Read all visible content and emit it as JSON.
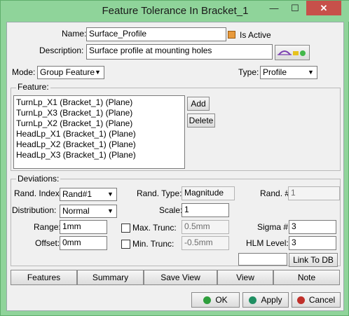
{
  "window": {
    "title": "Feature Tolerance In Bracket_1",
    "minimize_glyph": "—",
    "maximize_glyph": "☐",
    "close_glyph": "✕"
  },
  "header": {
    "name_label": "Name:",
    "name_value": "Surface_Profile",
    "is_active_label": "Is Active",
    "is_active_checked": true,
    "description_label": "Description:",
    "description_value": "Surface profile at mounting holes",
    "measure_icon": "measure-icon"
  },
  "mode": {
    "label": "Mode:",
    "value": "Group Feature",
    "type_label": "Type:",
    "type_value": "Profile"
  },
  "feature": {
    "group_label": "Feature:",
    "items": [
      "TurnLp_X1 (Bracket_1) (Plane)",
      "TurnLp_X3 (Bracket_1) (Plane)",
      "TurnLp_X2 (Bracket_1) (Plane)",
      "HeadLp_X1 (Bracket_1) (Plane)",
      "HeadLp_X2 (Bracket_1) (Plane)",
      "HeadLp_X3 (Bracket_1) (Plane)"
    ],
    "add_label": "Add",
    "delete_label": "Delete"
  },
  "deviations": {
    "group_label": "Deviations:",
    "rand_index_label": "Rand. Index:",
    "rand_index_value": "Rand#1",
    "rand_type_label": "Rand. Type:",
    "rand_type_value": "Magnitude",
    "rand_num_label": "Rand. #",
    "rand_num_value": "1",
    "distribution_label": "Distribution:",
    "distribution_value": "Normal",
    "scale_label": "Scale:",
    "scale_value": "1",
    "range_label": "Range:",
    "range_value": "1mm",
    "max_trunc_label": "Max. Trunc:",
    "max_trunc_value": "0.5mm",
    "sigma_label": "Sigma #",
    "sigma_value": "3",
    "offset_label": "Offset:",
    "offset_value": "0mm",
    "min_trunc_label": "Min. Trunc:",
    "min_trunc_value": "-0.5mm",
    "hlm_label": "HLM Level:",
    "hlm_value": "3",
    "link_label": "Link To DB"
  },
  "tabs": [
    "Features",
    "Summary",
    "Save View",
    "View",
    "Note"
  ],
  "footer": {
    "ok_label": "OK",
    "apply_label": "Apply",
    "cancel_label": "Cancel",
    "ok_color": "#2e9e3c",
    "apply_color": "#1f8f62",
    "cancel_color": "#c0302a"
  }
}
